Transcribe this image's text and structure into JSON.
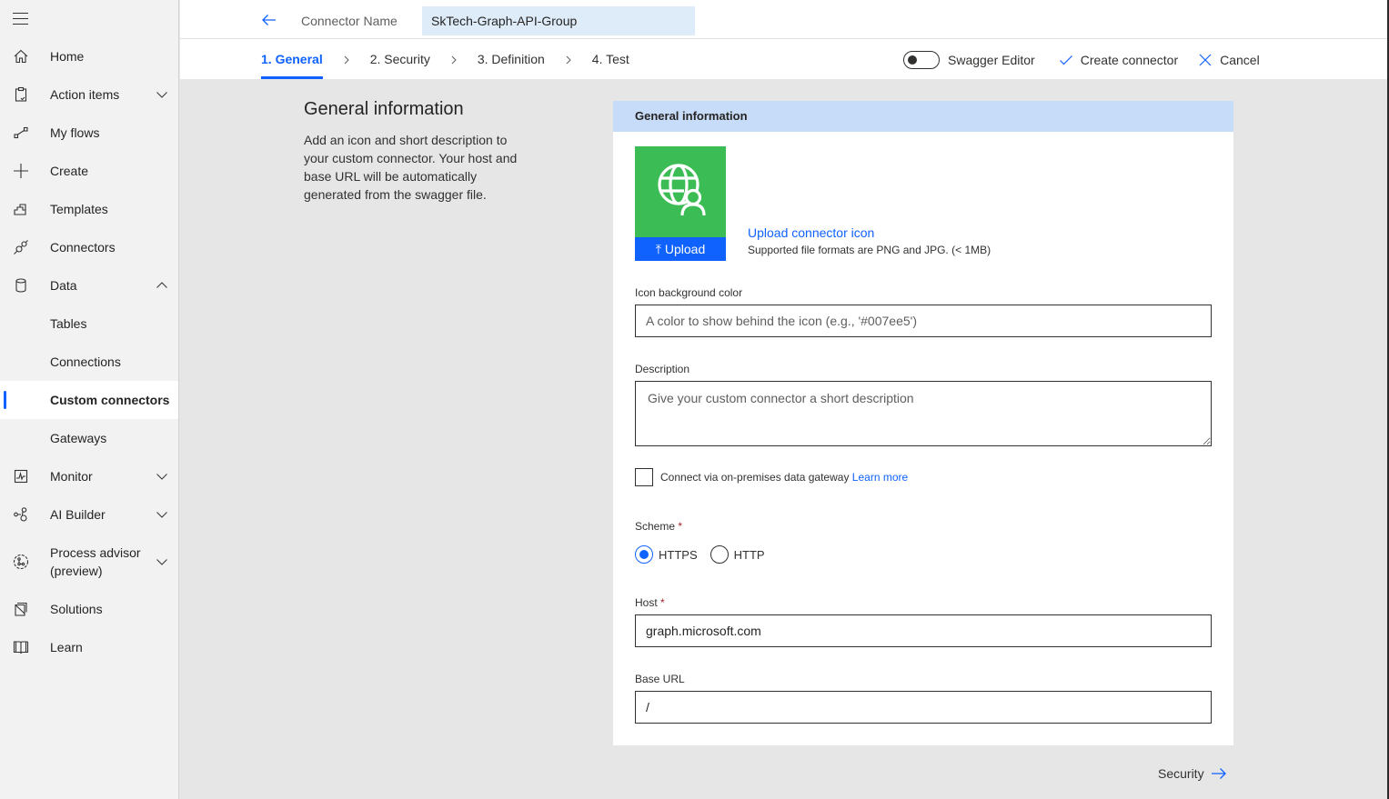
{
  "sidebar": {
    "items": [
      {
        "label": "Home",
        "icon": "home-icon"
      },
      {
        "label": "Action items",
        "icon": "clipboard-icon",
        "expandable": true,
        "expanded": false
      },
      {
        "label": "My flows",
        "icon": "flow-icon"
      },
      {
        "label": "Create",
        "icon": "plus-icon"
      },
      {
        "label": "Templates",
        "icon": "templates-icon"
      },
      {
        "label": "Connectors",
        "icon": "plug-icon"
      },
      {
        "label": "Data",
        "icon": "database-icon",
        "expandable": true,
        "expanded": true
      },
      {
        "label": "Tables"
      },
      {
        "label": "Connections"
      },
      {
        "label": "Custom connectors",
        "active": true
      },
      {
        "label": "Gateways"
      },
      {
        "label": "Monitor",
        "icon": "monitor-icon",
        "expandable": true,
        "expanded": false
      },
      {
        "label": "AI Builder",
        "icon": "ai-builder-icon",
        "expandable": true,
        "expanded": false
      },
      {
        "label": "Process advisor",
        "label2": "(preview)",
        "icon": "process-advisor-icon",
        "expandable": true,
        "expanded": false
      },
      {
        "label": "Solutions",
        "icon": "solutions-icon"
      },
      {
        "label": "Learn",
        "icon": "book-icon"
      }
    ]
  },
  "header": {
    "connector_name_label": "Connector Name",
    "connector_name_value": "SkTech-Graph-API-Group",
    "steps": [
      {
        "label": "1. General",
        "active": true
      },
      {
        "label": "2. Security"
      },
      {
        "label": "3. Definition"
      },
      {
        "label": "4. Test"
      }
    ],
    "swagger_editor_label": "Swagger Editor",
    "swagger_editor_on": false,
    "create_label": "Create connector",
    "cancel_label": "Cancel"
  },
  "intro": {
    "title": "General information",
    "description": "Add an icon and short description to your custom connector. Your host and base URL will be automatically generated from the swagger file."
  },
  "card": {
    "title": "General information",
    "upload_button": "Upload",
    "upload_link": "Upload connector icon",
    "upload_help": "Supported file formats are PNG and JPG. (< 1MB)",
    "icon_bg_label": "Icon background color",
    "icon_bg_placeholder": "A color to show behind the icon (e.g., '#007ee5')",
    "icon_bg_value": "",
    "description_label": "Description",
    "description_placeholder": "Give your custom connector a short description",
    "description_value": "",
    "gateway_label": "Connect via on-premises data gateway",
    "gateway_link": "Learn more",
    "gateway_checked": false,
    "scheme_label": "Scheme",
    "scheme_options": [
      "HTTPS",
      "HTTP"
    ],
    "scheme_selected": "HTTPS",
    "host_label": "Host",
    "host_value": "graph.microsoft.com",
    "base_url_label": "Base URL",
    "base_url_value": "/",
    "required_marker": "*"
  },
  "footer": {
    "next_label": "Security"
  },
  "colors": {
    "accent": "#0f62fe",
    "icon_bg": "#3cbc55",
    "card_header_bg": "#c7dcf8",
    "connector_name_bg": "#deecf9",
    "required": "#a4262c"
  }
}
